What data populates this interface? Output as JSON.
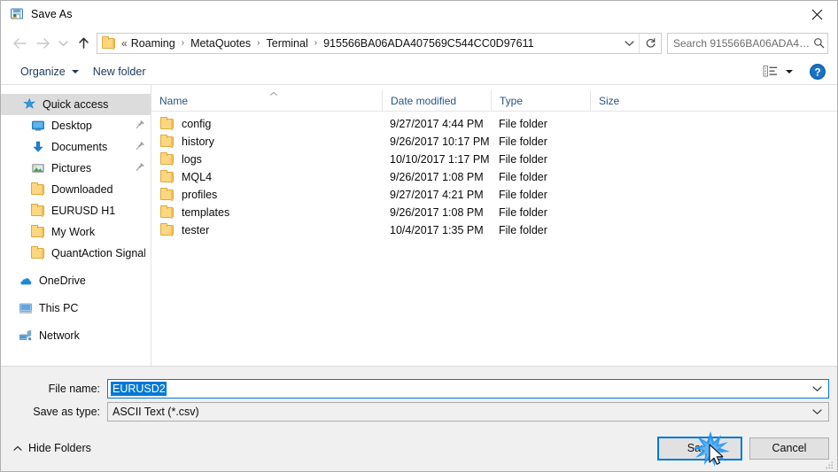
{
  "window": {
    "title": "Save As",
    "icon": "save-as-app-icon",
    "close_icon": "close-icon"
  },
  "nav": {
    "back_icon": "back-arrow-icon",
    "forward_icon": "forward-arrow-icon",
    "recent_icon": "chevron-down-icon",
    "up_icon": "up-arrow-icon",
    "folder_icon": "folder-icon",
    "overflow": "«",
    "breadcrumbs": [
      "Roaming",
      "MetaQuotes",
      "Terminal",
      "915566BA06ADA407569C544CC0D97611"
    ],
    "separator": "›",
    "address_dropdown_icon": "chevron-down-icon",
    "refresh_icon": "refresh-icon"
  },
  "search": {
    "placeholder": "Search 915566BA06ADA40756...",
    "icon": "search-icon"
  },
  "commandbar": {
    "organize": "Organize",
    "organize_caret_icon": "caret-down-icon",
    "new_folder": "New folder",
    "view_icon": "view-options-icon",
    "view_caret_icon": "caret-down-icon",
    "help_icon": "help-icon"
  },
  "sidebar": {
    "items": [
      {
        "label": "Quick access",
        "icon": "star-icon",
        "selected": true,
        "pinned": false,
        "indent": 0
      },
      {
        "label": "Desktop",
        "icon": "desktop-icon",
        "selected": false,
        "pinned": true,
        "indent": 1
      },
      {
        "label": "Documents",
        "icon": "download-icon",
        "selected": false,
        "pinned": true,
        "indent": 1
      },
      {
        "label": "Pictures",
        "icon": "pictures-icon",
        "selected": false,
        "pinned": true,
        "indent": 1
      },
      {
        "label": "Downloaded",
        "icon": "folder-icon",
        "selected": false,
        "pinned": false,
        "indent": 1
      },
      {
        "label": "EURUSD H1",
        "icon": "folder-icon",
        "selected": false,
        "pinned": false,
        "indent": 1
      },
      {
        "label": "My Work",
        "icon": "folder-icon",
        "selected": false,
        "pinned": false,
        "indent": 1
      },
      {
        "label": "QuantAction Signal",
        "icon": "folder-icon",
        "selected": false,
        "pinned": false,
        "indent": 1
      },
      {
        "label": "OneDrive",
        "icon": "onedrive-icon",
        "selected": false,
        "pinned": false,
        "indent": 0,
        "gap_before": true
      },
      {
        "label": "This PC",
        "icon": "thispc-icon",
        "selected": false,
        "pinned": false,
        "indent": 0,
        "gap_before": true
      },
      {
        "label": "Network",
        "icon": "network-icon",
        "selected": false,
        "pinned": false,
        "indent": 0,
        "gap_before": true
      }
    ]
  },
  "filelist": {
    "sort_indicator": "sort-ascending-icon",
    "columns": [
      "Name",
      "Date modified",
      "Type",
      "Size"
    ],
    "rows": [
      {
        "name": "config",
        "date": "9/27/2017 4:44 PM",
        "type": "File folder",
        "size": "",
        "icon": "folder-icon"
      },
      {
        "name": "history",
        "date": "9/26/2017 10:17 PM",
        "type": "File folder",
        "size": "",
        "icon": "folder-icon"
      },
      {
        "name": "logs",
        "date": "10/10/2017 1:17 PM",
        "type": "File folder",
        "size": "",
        "icon": "folder-icon"
      },
      {
        "name": "MQL4",
        "date": "9/26/2017 1:08 PM",
        "type": "File folder",
        "size": "",
        "icon": "folder-icon"
      },
      {
        "name": "profiles",
        "date": "9/27/2017 4:21 PM",
        "type": "File folder",
        "size": "",
        "icon": "folder-icon"
      },
      {
        "name": "templates",
        "date": "9/26/2017 1:08 PM",
        "type": "File folder",
        "size": "",
        "icon": "folder-icon"
      },
      {
        "name": "tester",
        "date": "10/4/2017 1:35 PM",
        "type": "File folder",
        "size": "",
        "icon": "folder-icon"
      }
    ]
  },
  "form": {
    "filename_label": "File name:",
    "filename_value": "EURUSD2",
    "filename_dropdown_icon": "chevron-down-icon",
    "filetype_label": "Save as type:",
    "filetype_value": "ASCII Text (*.csv)",
    "filetype_dropdown_icon": "chevron-down-icon"
  },
  "footer": {
    "hide_folders": "Hide Folders",
    "hide_folders_icon": "caret-up-icon",
    "save": "Save",
    "cancel": "Cancel",
    "resize_grip_icon": "resize-grip-icon",
    "cursor_icon": "mouse-cursor-icon",
    "click_burst_icon": "click-burst-icon"
  },
  "colors": {
    "accent": "#0078d7",
    "selection": "#dcdcdc",
    "folder": "#fcd77f",
    "link": "#1e395b"
  }
}
